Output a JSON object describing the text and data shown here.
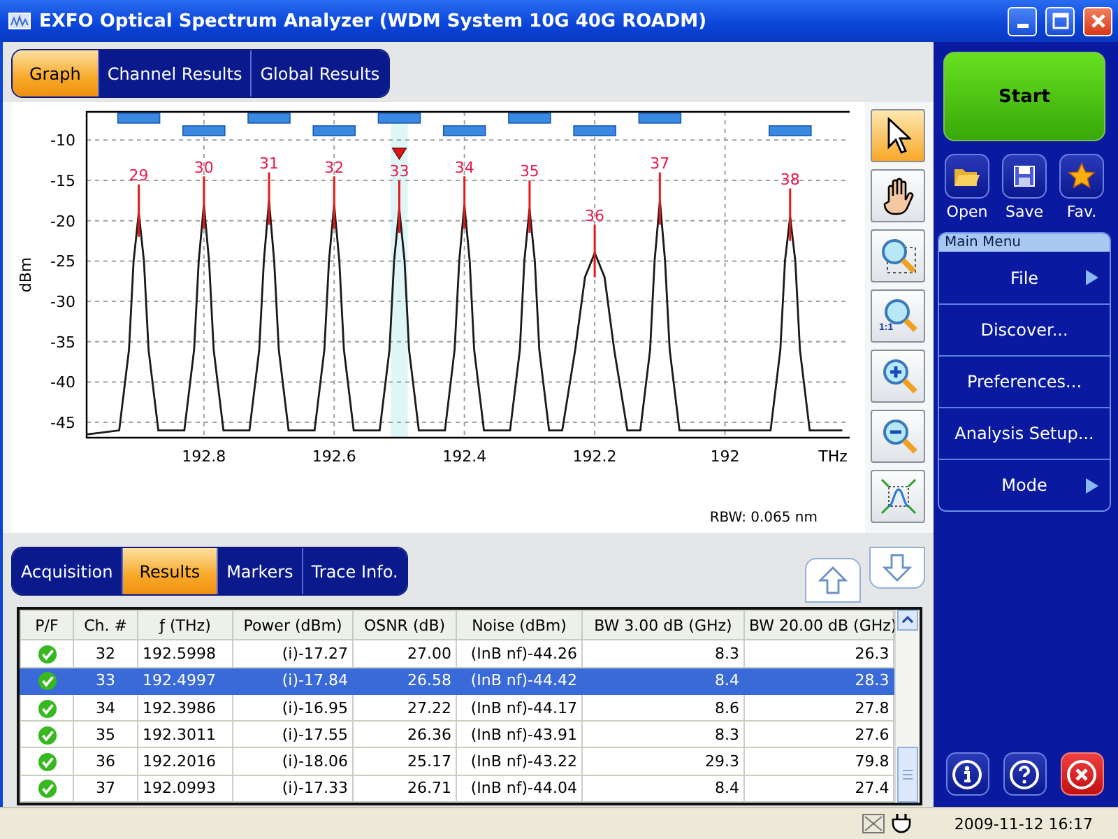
{
  "window": {
    "title": "EXFO Optical Spectrum Analyzer (WDM System 10G 40G ROADM)"
  },
  "view_tabs": [
    {
      "label": "Graph",
      "selected": true
    },
    {
      "label": "Channel Results",
      "selected": false
    },
    {
      "label": "Global Results",
      "selected": false
    }
  ],
  "graph": {
    "rbw": "RBW: 0.065 nm",
    "tools": [
      {
        "kind": "pointer",
        "selected": true
      },
      {
        "kind": "hand",
        "selected": false
      },
      {
        "kind": "zoom-area",
        "selected": false
      },
      {
        "kind": "zoom-reset",
        "label": "1:1",
        "selected": false
      },
      {
        "kind": "zoom-in",
        "selected": false
      },
      {
        "kind": "zoom-out",
        "selected": false
      },
      {
        "kind": "fit",
        "selected": false
      }
    ],
    "chart_data": {
      "type": "line",
      "xlabel": "THz",
      "ylabel": "dBm",
      "xlim": [
        192.98,
        191.8
      ],
      "ylim": [
        -46.9,
        -6.5
      ],
      "xticks": [
        192.8,
        192.6,
        192.4,
        192.2,
        192
      ],
      "yticks": [
        -10,
        -15,
        -20,
        -25,
        -30,
        -35,
        -40,
        -45
      ],
      "x": [
        192.98,
        192.93,
        192.915,
        192.908,
        192.9,
        192.892,
        192.885,
        192.87,
        192.83,
        192.815,
        192.808,
        192.8,
        192.792,
        192.785,
        192.77,
        192.73,
        192.715,
        192.708,
        192.7,
        192.692,
        192.685,
        192.67,
        192.63,
        192.615,
        192.608,
        192.6,
        192.592,
        192.585,
        192.57,
        192.53,
        192.515,
        192.508,
        192.5,
        192.492,
        192.485,
        192.47,
        192.43,
        192.415,
        192.408,
        192.4,
        192.392,
        192.385,
        192.37,
        192.33,
        192.315,
        192.308,
        192.3,
        192.292,
        192.285,
        192.27,
        192.25,
        192.23,
        192.215,
        192.2,
        192.185,
        192.17,
        192.15,
        192.13,
        192.115,
        192.108,
        192.1,
        192.092,
        192.085,
        192.07,
        191.93,
        191.915,
        191.908,
        191.9,
        191.892,
        191.885,
        191.87,
        191.82
      ],
      "series": [
        {
          "color": "#1a1a1a",
          "values": [
            -46.5,
            -46,
            -36,
            -25,
            -19,
            -25,
            -36,
            -46,
            -46,
            -36,
            -25,
            -18,
            -25,
            -36,
            -46,
            -46,
            -36,
            -25,
            -17.5,
            -25,
            -36,
            -46,
            -46,
            -36,
            -25,
            -18,
            -25,
            -36,
            -46,
            -46,
            -36,
            -25,
            -18.5,
            -25,
            -36,
            -46,
            -46,
            -36,
            -25,
            -18,
            -25,
            -36,
            -46,
            -46,
            -36,
            -25,
            -18.5,
            -25,
            -36,
            -46,
            -46,
            -36,
            -27,
            -24,
            -27,
            -36,
            -46,
            -46,
            -36,
            -25,
            -17.5,
            -25,
            -36,
            -46,
            -46,
            -36,
            -25,
            -19.5,
            -25,
            -36,
            -46,
            -46
          ]
        }
      ],
      "grid": true,
      "bands": [
        {
          "axis": "x",
          "from": 192.513,
          "to": 192.487,
          "color": "#dff6f6"
        }
      ],
      "annotations": [
        {
          "x": 192.9,
          "y": -19,
          "text": "29"
        },
        {
          "x": 192.8,
          "y": -18,
          "text": "30"
        },
        {
          "x": 192.7,
          "y": -17.5,
          "text": "31"
        },
        {
          "x": 192.6,
          "y": -18,
          "text": "32"
        },
        {
          "x": 192.5,
          "y": -18.5,
          "text": "33"
        },
        {
          "x": 192.4,
          "y": -18,
          "text": "34"
        },
        {
          "x": 192.3,
          "y": -18.5,
          "text": "35"
        },
        {
          "x": 192.2,
          "y": -24,
          "text": "36"
        },
        {
          "x": 192.1,
          "y": -17.5,
          "text": "37"
        },
        {
          "x": 191.9,
          "y": -19.5,
          "text": "38"
        }
      ]
    }
  },
  "panel_tabs": [
    {
      "label": "Acquisition",
      "selected": false
    },
    {
      "label": "Results",
      "selected": true
    },
    {
      "label": "Markers",
      "selected": false
    },
    {
      "label": "Trace Info.",
      "selected": false
    }
  ],
  "table": {
    "columns": [
      "P/F",
      "Ch. #",
      "ƒ (THz)",
      "Power (dBm)",
      "OSNR (dB)",
      "Noise (dBm)",
      "BW 3.00 dB (GHz)",
      "BW 20.00 dB (GHz)"
    ],
    "rows": [
      {
        "pass": true,
        "selected": false,
        "cells": [
          "",
          "32",
          "192.5998",
          "(i)-17.27",
          "27.00",
          "(InB nf)-44.26",
          "8.3",
          "26.3"
        ]
      },
      {
        "pass": true,
        "selected": true,
        "cells": [
          "",
          "33",
          "192.4997",
          "(i)-17.84",
          "26.58",
          "(InB nf)-44.42",
          "8.4",
          "28.3"
        ]
      },
      {
        "pass": true,
        "selected": false,
        "cells": [
          "",
          "34",
          "192.3986",
          "(i)-16.95",
          "27.22",
          "(InB nf)-44.17",
          "8.6",
          "27.8"
        ]
      },
      {
        "pass": true,
        "selected": false,
        "cells": [
          "",
          "35",
          "192.3011",
          "(i)-17.55",
          "26.36",
          "(InB nf)-43.91",
          "8.3",
          "27.6"
        ]
      },
      {
        "pass": true,
        "selected": false,
        "cells": [
          "",
          "36",
          "192.2016",
          "(i)-18.06",
          "25.17",
          "(InB nf)-43.22",
          "29.3",
          "79.8"
        ]
      },
      {
        "pass": true,
        "selected": false,
        "cells": [
          "",
          "37",
          "192.0993",
          "(i)-17.33",
          "26.71",
          "(InB nf)-44.04",
          "8.4",
          "27.4"
        ]
      }
    ]
  },
  "side": {
    "start": "Start",
    "actions": [
      {
        "kind": "open",
        "label": "Open"
      },
      {
        "kind": "save",
        "label": "Save"
      },
      {
        "kind": "favorites",
        "label": "Fav."
      }
    ],
    "menu_title": "Main Menu",
    "menu": [
      {
        "label": "File",
        "submenu": true
      },
      {
        "label": "Discover...",
        "submenu": false
      },
      {
        "label": "Preferences...",
        "submenu": false
      },
      {
        "label": "Analysis Setup...",
        "submenu": false
      },
      {
        "label": "Mode",
        "submenu": true
      }
    ]
  },
  "status_bar": {
    "datetime": "2009-11-12 16:17"
  }
}
